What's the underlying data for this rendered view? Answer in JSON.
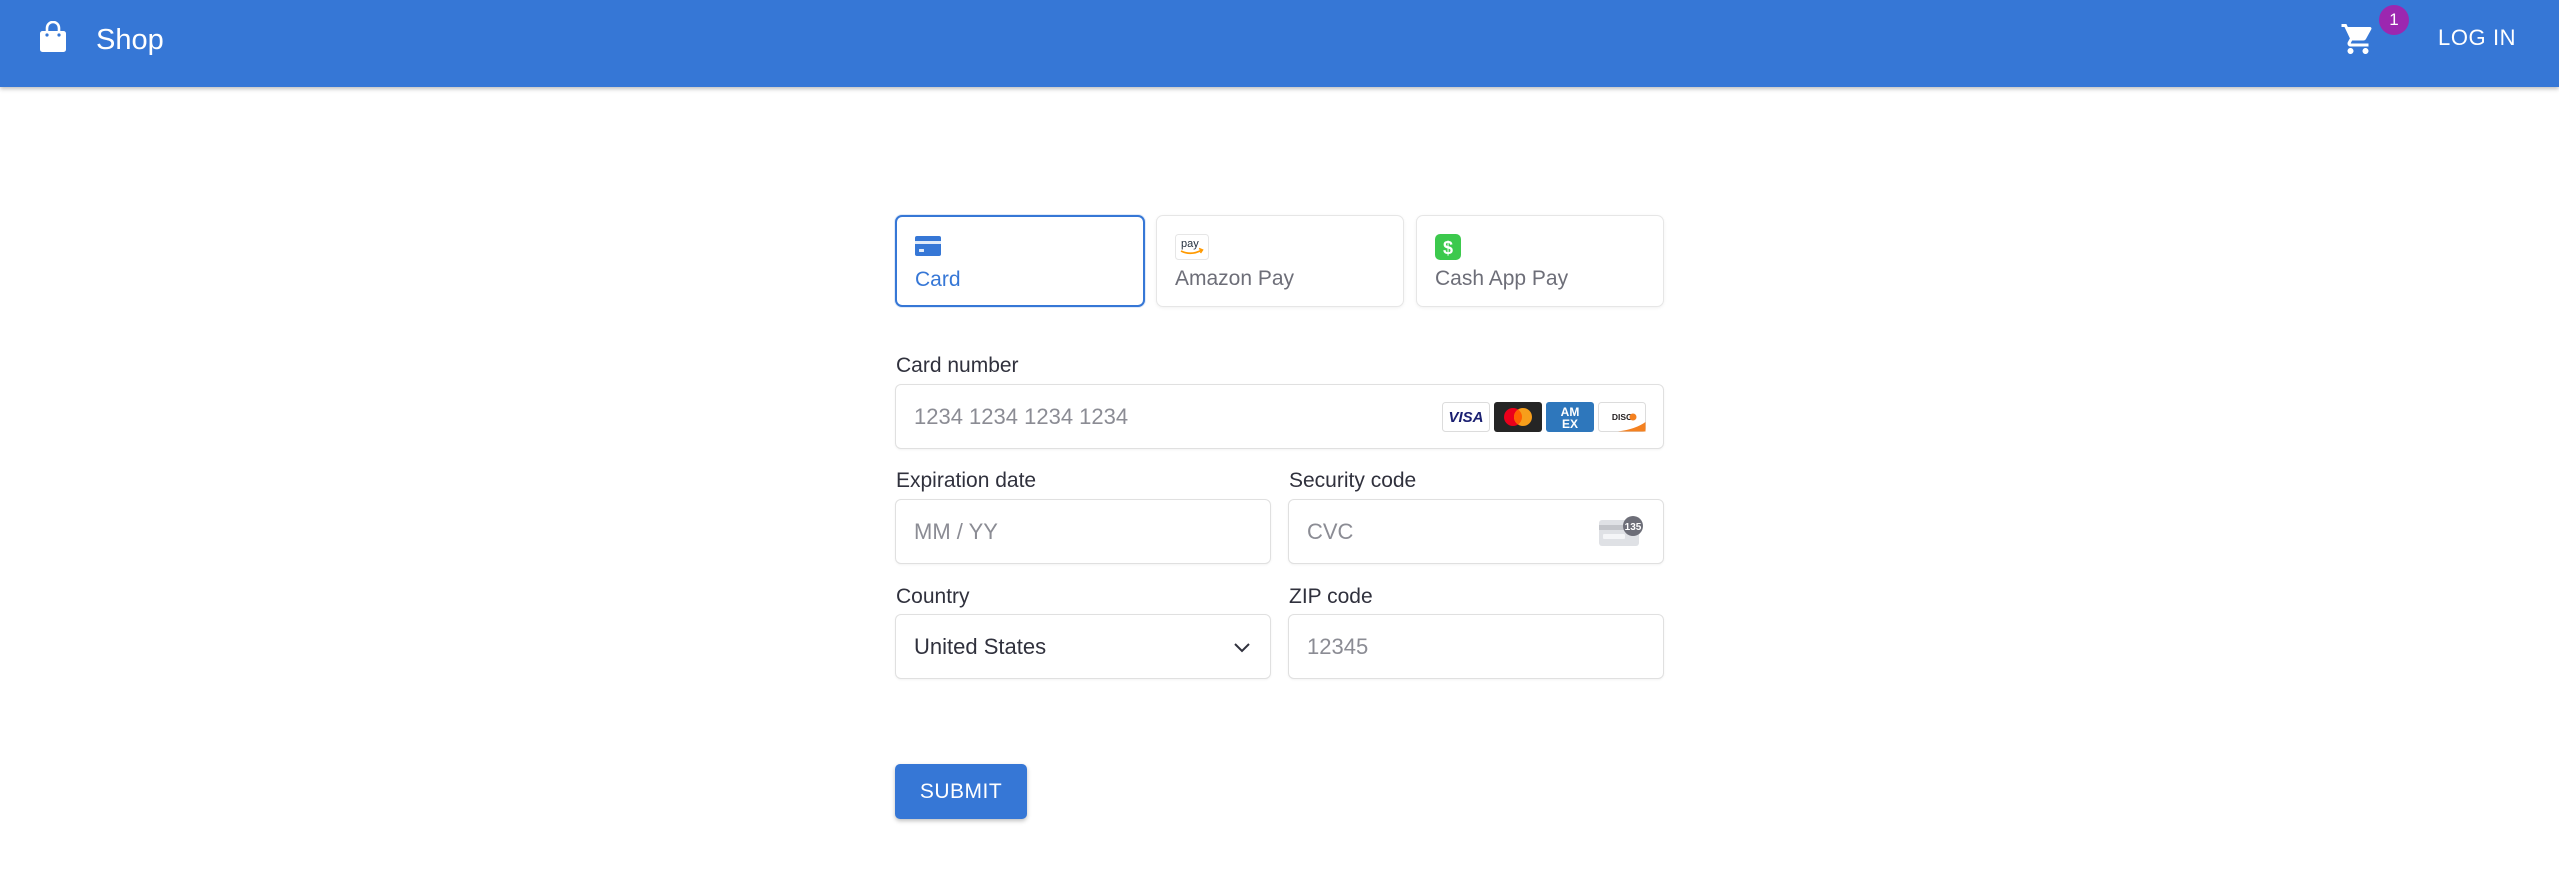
{
  "header": {
    "brand": "Shop",
    "cart_count": "1",
    "login_label": "LOG IN",
    "bar_color": "#3677d6",
    "badge_color": "#9c27b0",
    "icons": [
      "shopping-bag-icon",
      "cart-icon"
    ]
  },
  "payment_methods": [
    {
      "label": "Card",
      "icon": "card-icon",
      "selected": true
    },
    {
      "label": "Amazon Pay",
      "icon": "amazon-pay-icon",
      "selected": false
    },
    {
      "label": "Cash App Pay",
      "icon": "cash-app-icon",
      "selected": false
    }
  ],
  "form": {
    "card_number": {
      "label": "Card number",
      "placeholder": "1234 1234 1234 1234",
      "value": "",
      "brands": [
        "VISA",
        "Mastercard",
        "AMEX",
        "DISCOVER"
      ]
    },
    "expiration": {
      "label": "Expiration date",
      "placeholder": "MM / YY",
      "value": ""
    },
    "security_code": {
      "label": "Security code",
      "placeholder": "CVC",
      "value": "",
      "icon_text": "135"
    },
    "country": {
      "label": "Country",
      "value": "United States"
    },
    "zip": {
      "label": "ZIP code",
      "placeholder": "12345",
      "value": ""
    }
  },
  "submit_label": "SUBMIT",
  "accent_color": "#3677d6"
}
